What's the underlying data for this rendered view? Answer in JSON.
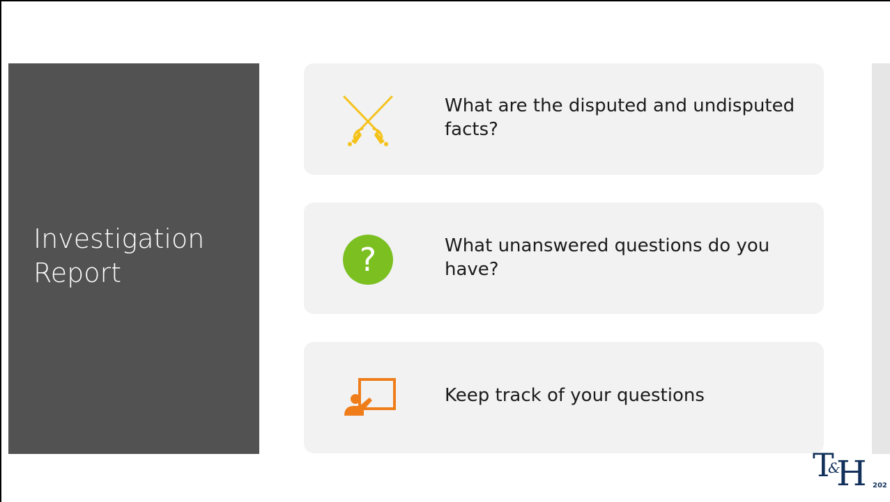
{
  "slide": {
    "title": "Investigation Report",
    "cards": [
      {
        "icon": "crossed-swords-icon",
        "text": "What are the disputed and undisputed facts?"
      },
      {
        "icon": "question-mark-icon",
        "text": "What unanswered questions do you have?"
      },
      {
        "icon": "presenter-board-icon",
        "text": "Keep track of your questions"
      }
    ],
    "logo": "T&H",
    "page_number": "202"
  },
  "colors": {
    "title_panel": "#525252",
    "card_background": "#f2f2f2",
    "swords": "#f5c21a",
    "question_circle": "#7bbf21",
    "presenter": "#ef7d1a",
    "logo": "#12305a"
  }
}
